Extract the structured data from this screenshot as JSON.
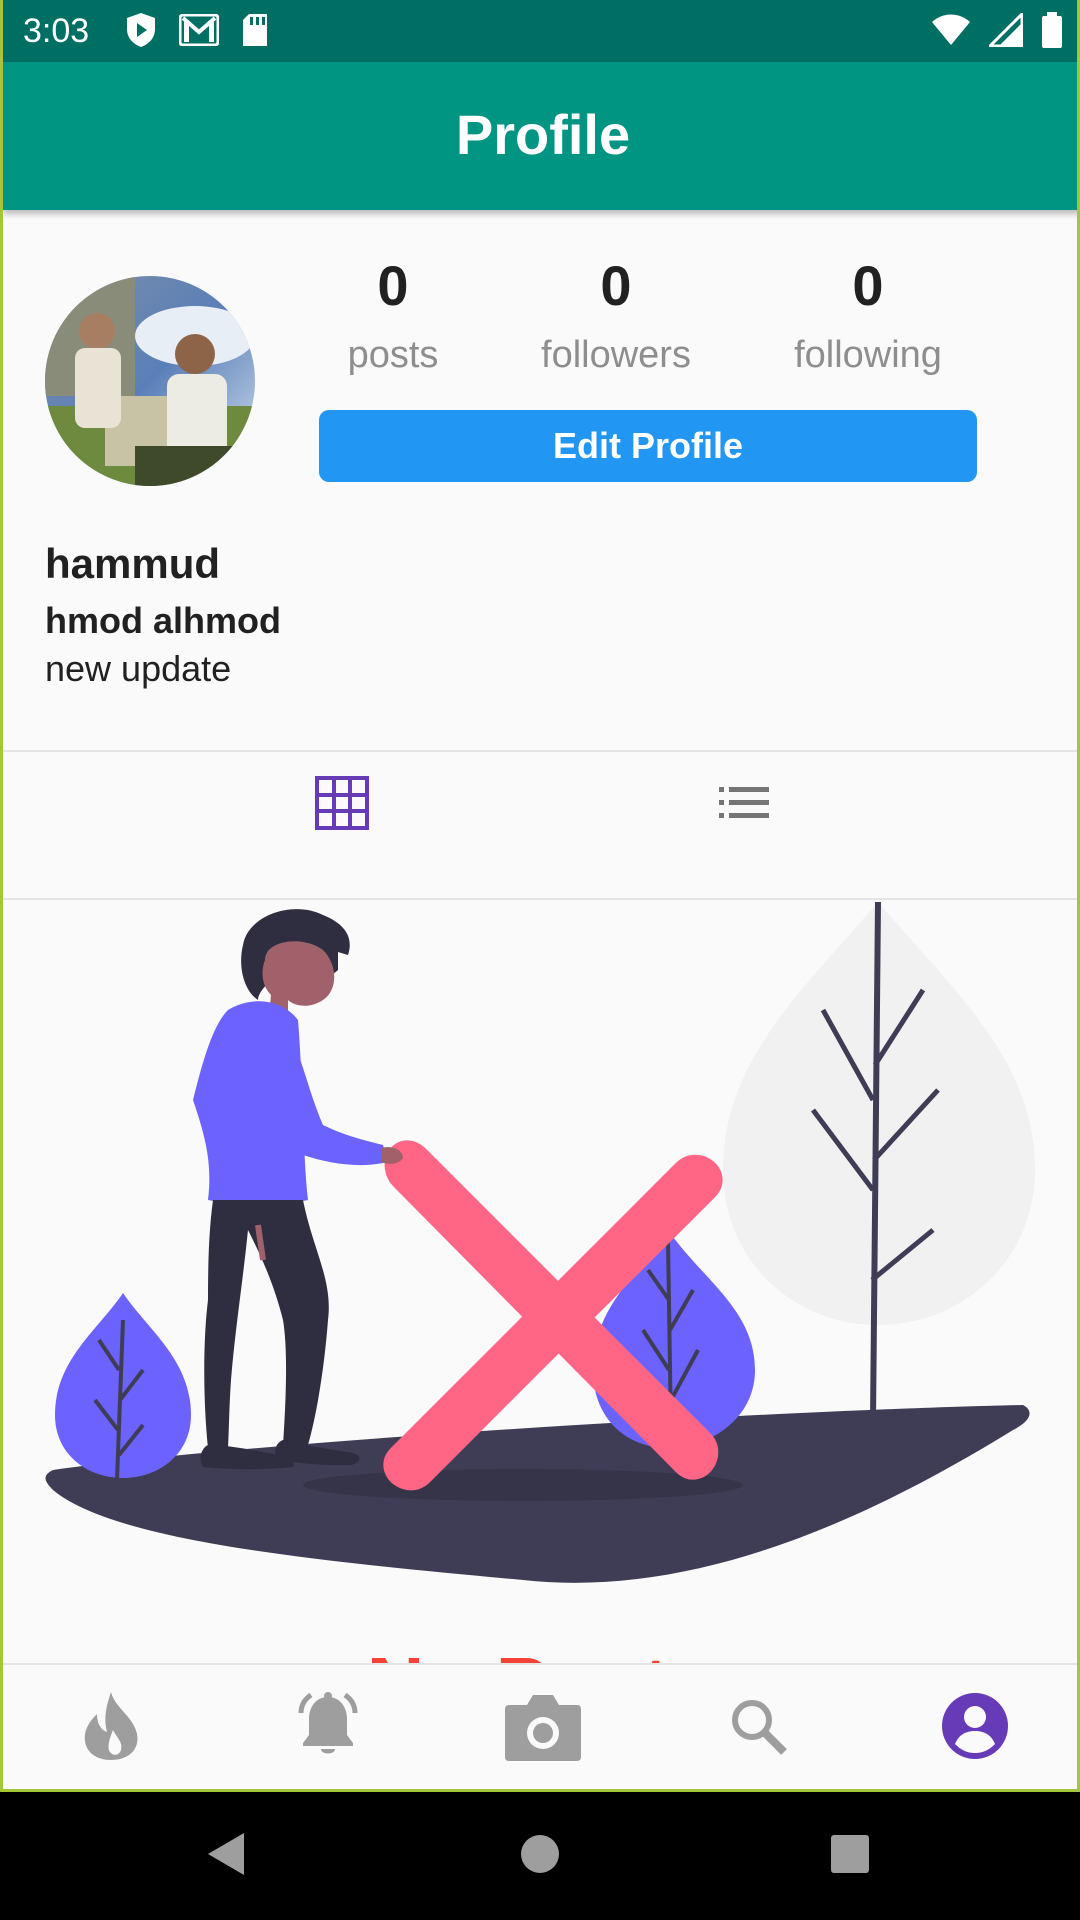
{
  "status_bar": {
    "time": "3:03",
    "icons": [
      "play-protect-icon",
      "gmail-icon",
      "sd-card-icon",
      "wifi-icon",
      "signal-icon",
      "battery-icon"
    ]
  },
  "app_bar": {
    "title": "Profile"
  },
  "profile": {
    "stats": [
      {
        "value": "0",
        "label": "posts"
      },
      {
        "value": "0",
        "label": "followers"
      },
      {
        "value": "0",
        "label": "following"
      }
    ],
    "edit_button": "Edit Profile",
    "username": "hammud",
    "full_name": "hmod alhmod",
    "bio": "new update"
  },
  "view_toggle": {
    "active": "grid",
    "options": [
      "grid-icon",
      "list-icon"
    ]
  },
  "empty_state": {
    "text": "No Posts"
  },
  "bottom_nav": {
    "items": [
      "fire-icon",
      "bell-icon",
      "camera-icon",
      "search-icon",
      "account-icon"
    ],
    "active": "account-icon"
  },
  "colors": {
    "status_bar": "#006f63",
    "app_bar": "#009583",
    "button": "#2196f3",
    "accent": "#673ab7",
    "figure": "#6c63ff",
    "cross": "#ff6584",
    "ground": "#3f3d56"
  }
}
